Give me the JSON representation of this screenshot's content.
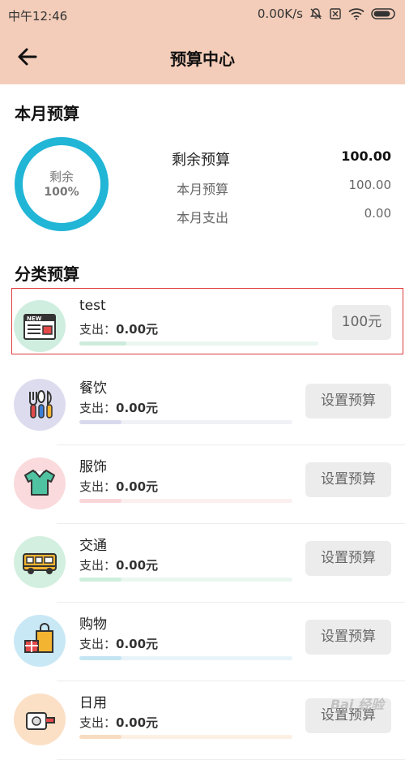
{
  "status_bar": {
    "time": "中午12:46",
    "speed": "0.00K/s"
  },
  "nav": {
    "title": "预算中心"
  },
  "monthly": {
    "section_title": "本月预算",
    "ring_label": "剩余",
    "ring_percent": "100%",
    "ring_fraction": 1.0,
    "remaining_label": "剩余预算",
    "remaining_value": "100.00",
    "budget_label": "本月预算",
    "budget_value": "100.00",
    "spent_label": "本月支出",
    "spent_value": "0.00",
    "ring_color": "#21b5d6"
  },
  "category": {
    "section_title": "分类预算",
    "items": [
      {
        "name": "test",
        "spent_label": "支出：",
        "spent_value": "0.00元",
        "button": "100元",
        "icon": "news-icon",
        "circle_color": "#cfeee0",
        "bar_color": "#cdebdc",
        "track_color": "#eaf7f1",
        "progress": 0.0
      },
      {
        "name": "餐饮",
        "spent_label": "支出：",
        "spent_value": "0.00元",
        "button": "设置预算",
        "icon": "cutlery-icon",
        "circle_color": "#dcdcee",
        "bar_color": "#d9d9ee",
        "track_color": "#f0f0f7",
        "progress": 0.0
      },
      {
        "name": "服饰",
        "spent_label": "支出：",
        "spent_value": "0.00元",
        "button": "设置预算",
        "icon": "shirt-icon",
        "circle_color": "#fadadc",
        "bar_color": "#f9d7d9",
        "track_color": "#fcefef",
        "progress": 0.0
      },
      {
        "name": "交通",
        "spent_label": "支出：",
        "spent_value": "0.00元",
        "button": "设置预算",
        "icon": "bus-icon",
        "circle_color": "#d3efdf",
        "bar_color": "#cfeedd",
        "track_color": "#eaf7f0",
        "progress": 0.0
      },
      {
        "name": "购物",
        "spent_label": "支出：",
        "spent_value": "0.00元",
        "button": "设置预算",
        "icon": "shopping-bag-icon",
        "circle_color": "#c9e8f5",
        "bar_color": "#c5e5f3",
        "track_color": "#e8f4fa",
        "progress": 0.0
      },
      {
        "name": "日用",
        "spent_label": "支出：",
        "spent_value": "0.00元",
        "button": "设置预算",
        "icon": "daily-goods-icon",
        "circle_color": "#fbe0c6",
        "bar_color": "#f8dcc2",
        "track_color": "#fcf0e5",
        "progress": 0.0
      }
    ]
  },
  "watermark": "Bai 经验"
}
